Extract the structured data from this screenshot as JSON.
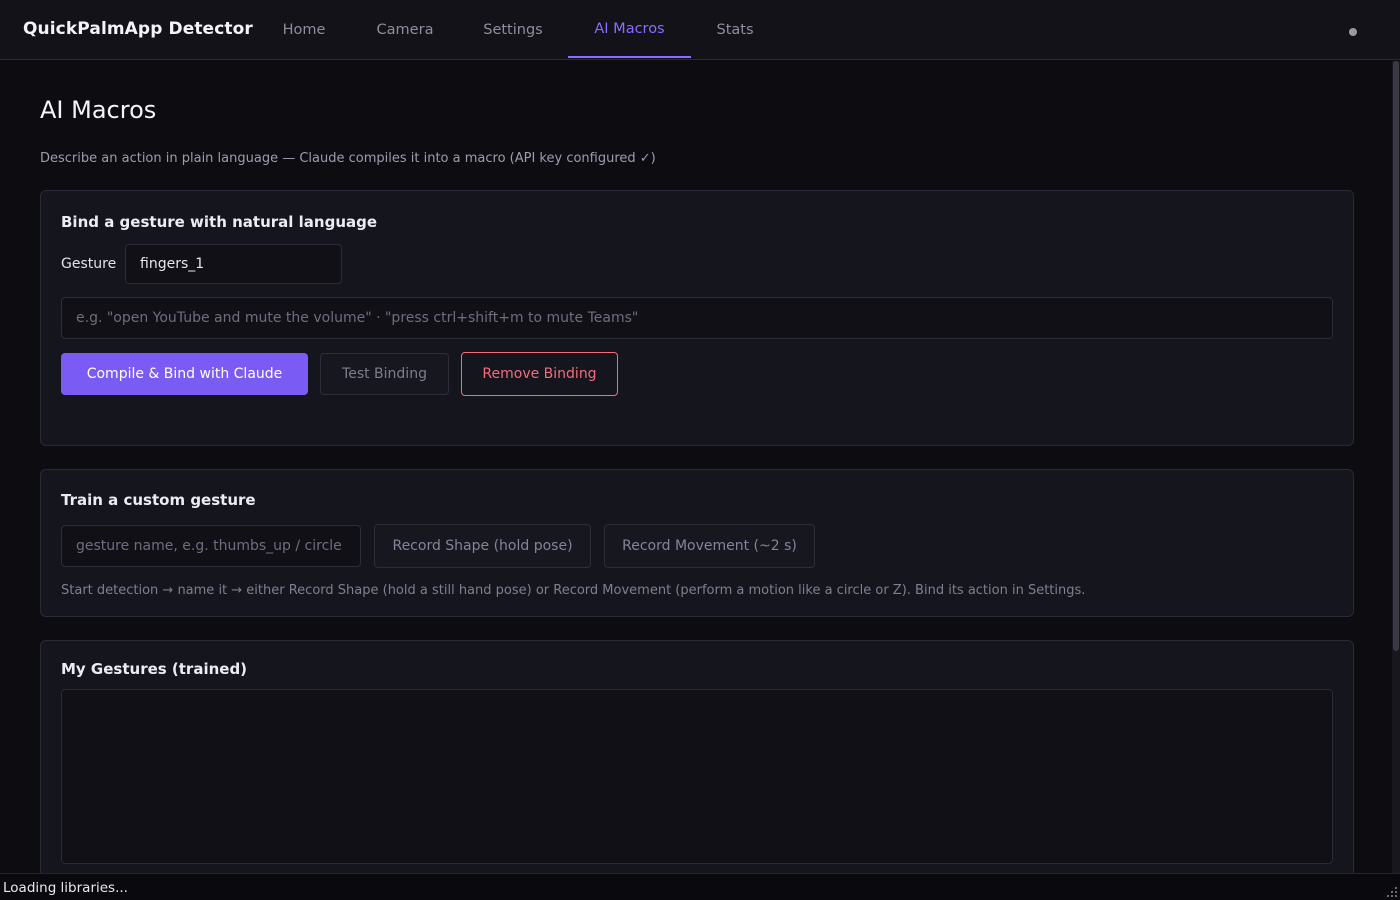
{
  "app": {
    "title": "QuickPalmApp Detector",
    "accent_color": "#7a5cf5",
    "danger_color": "#f26d7d"
  },
  "nav": {
    "tabs": [
      {
        "label": "Home",
        "active": false
      },
      {
        "label": "Camera",
        "active": false
      },
      {
        "label": "Settings",
        "active": false
      },
      {
        "label": "AI Macros",
        "active": true
      },
      {
        "label": "Stats",
        "active": false
      }
    ]
  },
  "page": {
    "title": "AI Macros",
    "description": "Describe an action in plain language — Claude compiles it into a macro (API key configured ✓)"
  },
  "bind_card": {
    "title": "Bind a gesture with natural language",
    "gesture_label": "Gesture",
    "gesture_value": "fingers_1",
    "macro_placeholder": "e.g. \"open YouTube and mute the volume\"  ·  \"press ctrl+shift+m to mute Teams\"",
    "compile_button": "Compile & Bind with Claude",
    "test_button": "Test Binding",
    "remove_button": "Remove Binding"
  },
  "train_card": {
    "title": "Train a custom gesture",
    "name_placeholder": "gesture name, e.g. thumbs_up / circle",
    "record_shape_button": "Record Shape (hold pose)",
    "record_movement_button": "Record Movement (~2 s)",
    "hint": "Start detection → name it → either Record Shape (hold a still hand pose) or Record Movement (perform a motion like a circle or Z). Bind its action in Settings."
  },
  "gestures_card": {
    "title": "My Gestures (trained)"
  },
  "status": {
    "text": "Loading libraries..."
  }
}
